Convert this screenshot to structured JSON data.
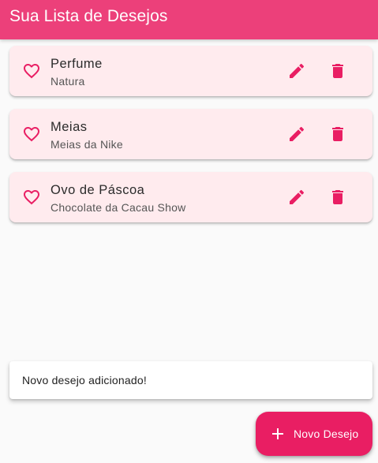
{
  "app": {
    "title": "Sua Lista de Desejos",
    "colors": {
      "appbar": "#ec407a",
      "card_background": "#ffebee",
      "accent": "#e91e63",
      "background": "#fafafa"
    }
  },
  "wishes": [
    {
      "title": "Perfume",
      "subtitle": "Natura",
      "icon": "heart-outline-icon",
      "actions": [
        "edit-icon",
        "delete-icon"
      ]
    },
    {
      "title": "Meias",
      "subtitle": "Meias da Nike",
      "icon": "heart-outline-icon",
      "actions": [
        "edit-icon",
        "delete-icon"
      ]
    },
    {
      "title": "Ovo de Páscoa",
      "subtitle": "Chocolate da Cacau Show",
      "icon": "heart-outline-icon",
      "actions": [
        "edit-icon",
        "delete-icon"
      ]
    }
  ],
  "snackbar": {
    "message": "Novo desejo adicionado!"
  },
  "fab": {
    "label": "Novo Desejo",
    "icon": "plus-icon"
  }
}
